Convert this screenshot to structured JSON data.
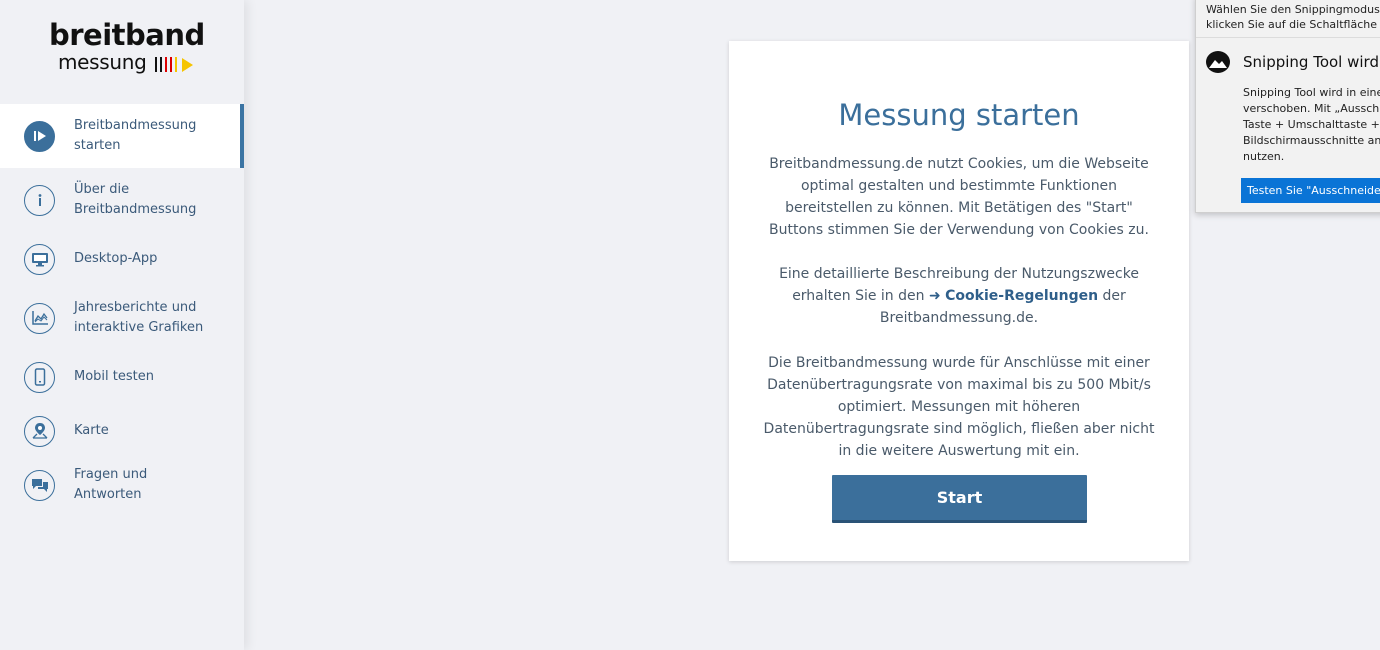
{
  "logo": {
    "main": "breitband",
    "sub": "messung"
  },
  "colors": {
    "accent": "#3b6f9b",
    "flag_black": "#111111",
    "flag_red": "#dd0000",
    "flag_gold": "#f5c400",
    "toast_button": "#0a74d6"
  },
  "sidebar": {
    "items": [
      {
        "label": "Breitbandmessung starten",
        "icon": "play-circle-icon",
        "active": true
      },
      {
        "label": "Über die Breitbandmessung",
        "icon": "info-icon",
        "active": false
      },
      {
        "label": "Desktop-App",
        "icon": "monitor-icon",
        "active": false
      },
      {
        "label": "Jahresberichte und interaktive Grafiken",
        "icon": "chart-icon",
        "active": false
      },
      {
        "label": "Mobil testen",
        "icon": "smartphone-icon",
        "active": false
      },
      {
        "label": "Karte",
        "icon": "map-pin-icon",
        "active": false
      },
      {
        "label": "Fragen und Antworten",
        "icon": "chat-icon",
        "active": false
      }
    ]
  },
  "card": {
    "title": "Messung starten",
    "p1": "Breitbandmessung.de nutzt Cookies, um die Webseite optimal gestalten und bestimmte Funktionen bereitstellen zu können. Mit Betätigen des \"Start\" Buttons stimmen Sie der Verwendung von Cookies zu.",
    "p2_before": "Eine detaillierte Beschreibung der Nutzungszwecke erhalten Sie in den",
    "p2_link": "Cookie-Regelungen",
    "p2_after": "der Breitbandmessung.de.",
    "p3": "Die Breitbandmessung wurde für Anschlüsse mit einer Datenübertragungsrate von maximal bis zu 500 Mbit/s optimiert. Messungen mit höheren Datenübertragungsrate sind möglich, fließen aber nicht in die weitere Auswertung mit ein.",
    "start_label": "Start"
  },
  "toast": {
    "top_line1": "Wählen Sie den Snippingmodus r",
    "top_line2": "klicken Sie auf die Schaltfläche \"N",
    "title": "Snipping Tool wird v",
    "body_line1": "Snipping Tool wird in eine",
    "body_line2": "verschoben. Mit „Ausschn",
    "body_line3": "Taste + Umschalttaste + S",
    "body_line4": "Bildschirmausschnitte anfe",
    "body_line5": "nutzen.",
    "button_label": "Testen Sie \"Ausschneiden"
  }
}
